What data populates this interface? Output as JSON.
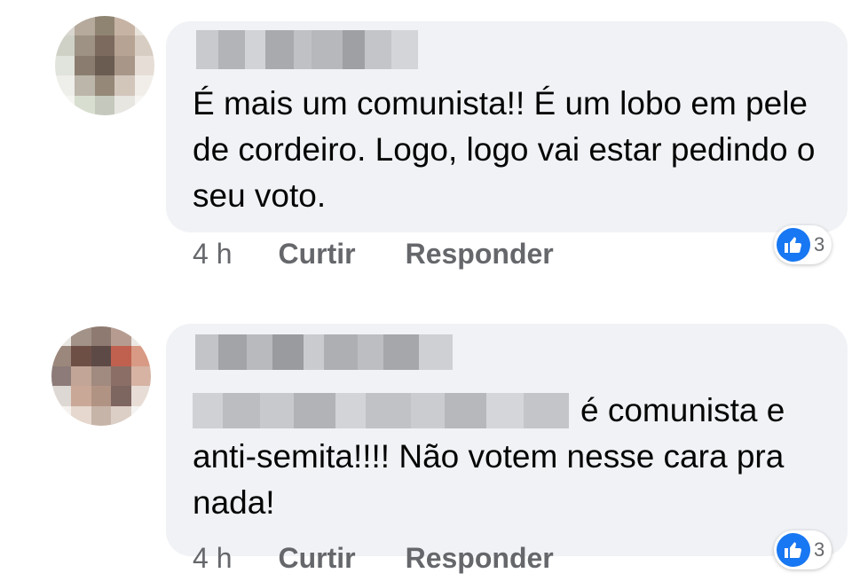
{
  "comments": [
    {
      "text": "É mais um comunista!! É um lobo em pele de cordeiro. Logo, logo vai estar pedindo o seu voto.",
      "time": "4 h",
      "like_label": "Curtir",
      "reply_label": "Responder",
      "reaction_count": "3",
      "reaction_icon": "thumbs-up-icon"
    },
    {
      "text": "é comunista e anti-semita!!!! Não votem nesse cara pra nada!",
      "time": "4 h",
      "like_label": "Curtir",
      "reply_label": "Responder",
      "reaction_count": "3",
      "reaction_icon": "thumbs-up-icon"
    }
  ],
  "colors": {
    "bubble_bg": "#f0f2f5",
    "text": "#050505",
    "meta": "#65676b",
    "like_blue": "#1877f2"
  }
}
